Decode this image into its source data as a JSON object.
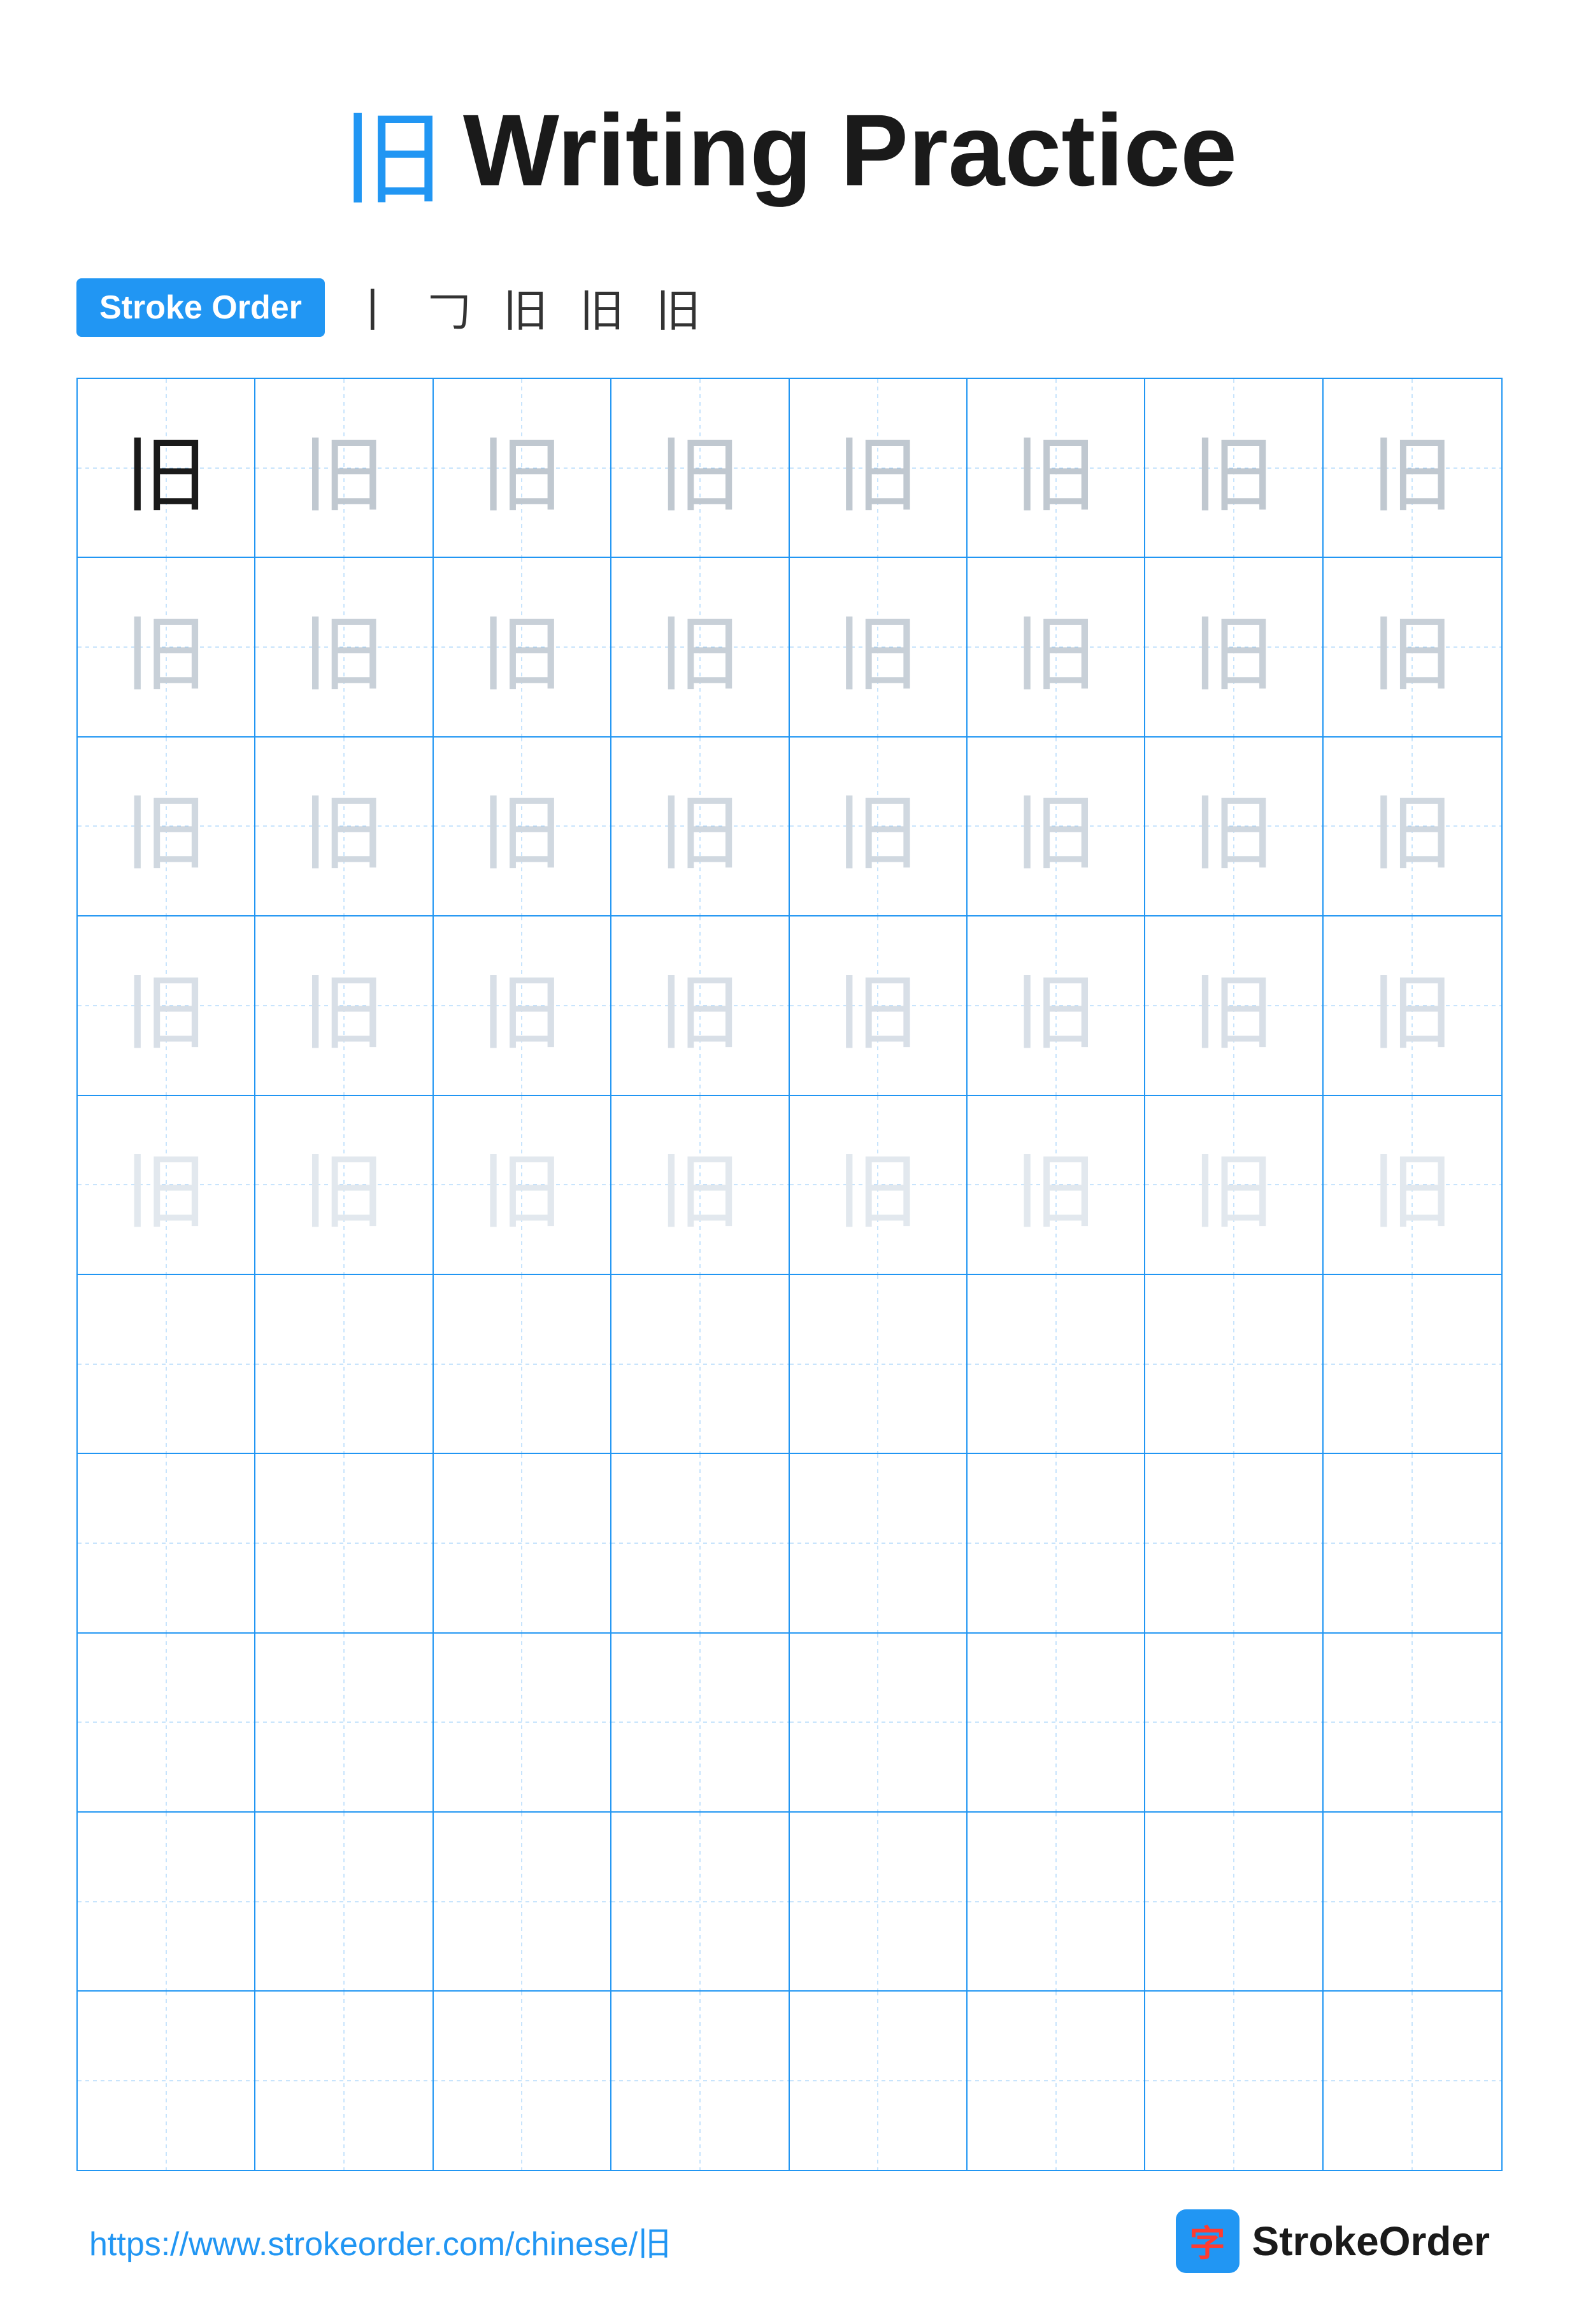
{
  "page": {
    "title_char": "旧",
    "title_text": "Writing Practice",
    "stroke_order_label": "Stroke Order",
    "stroke_steps": [
      "丨",
      "𠃌",
      "𠃑",
      "旧",
      "旧"
    ],
    "character": "旧",
    "grid": {
      "rows": 10,
      "cols": 8,
      "filled_rows": 5,
      "empty_rows": 5
    },
    "footer": {
      "url": "https://www.strokeorder.com/chinese/旧",
      "brand_char": "字",
      "brand_name": "StrokeOrder"
    }
  }
}
